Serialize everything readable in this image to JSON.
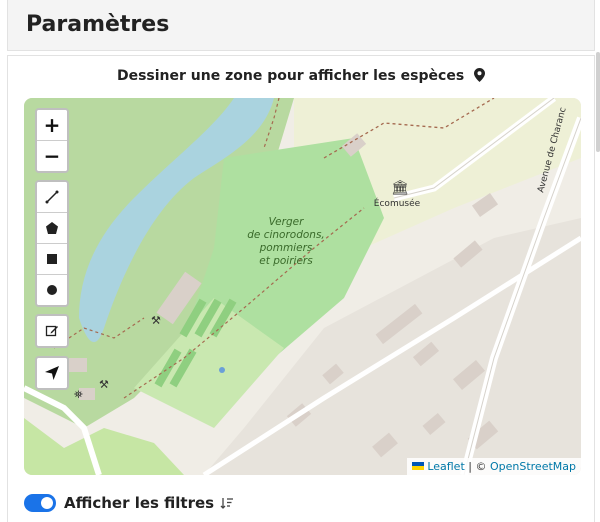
{
  "header": {
    "title": "Paramètres"
  },
  "map_section": {
    "title": "Dessiner une zone pour afficher les espèces",
    "pin_icon": "map-pin-icon"
  },
  "map": {
    "labels": {
      "orchard_line1": "Verger",
      "orchard_line2": "de cinorodons,",
      "orchard_line3": "pommiers",
      "orchard_line4": "et poiriers",
      "museum": "Écomusée",
      "avenue": "Avenue de Charanc"
    },
    "zoom_in": "+",
    "zoom_out": "−",
    "draw_tools": [
      "polyline-icon",
      "polygon-icon",
      "rectangle-icon",
      "circle-icon"
    ],
    "edit_tool": "edit-icon",
    "locate_tool": "locate-arrow-icon",
    "attribution": {
      "leaflet": "Leaflet",
      "separator": " | © ",
      "osm": "OpenStreetMap"
    }
  },
  "filters": {
    "label": "Afficher les filtres",
    "toggle_on": true,
    "sort_icon": "sort-descending-icon"
  },
  "colors": {
    "accent": "#1a73e8",
    "park": "#c8e6b0",
    "water": "#aad3df",
    "orchard": "#aee0a0"
  }
}
